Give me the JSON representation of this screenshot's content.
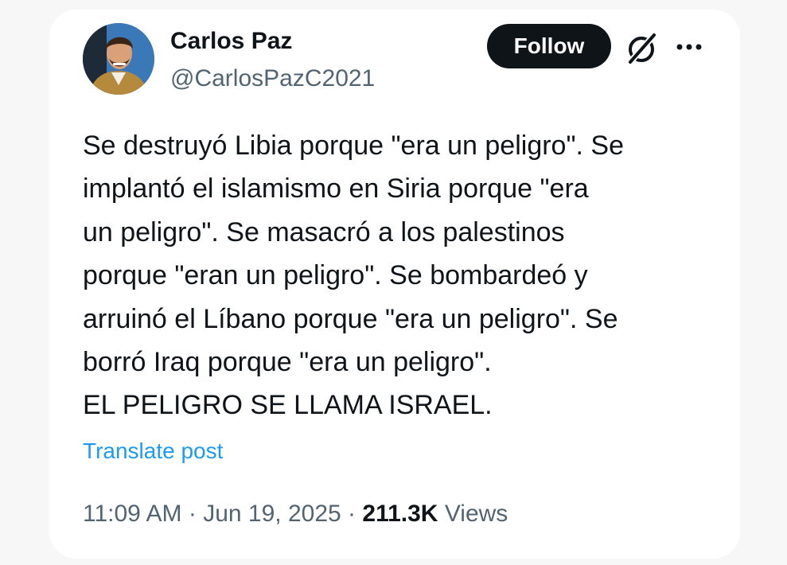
{
  "author": {
    "name": "Carlos Paz",
    "handle": "@CarlosPazC2021",
    "avatar_icon": "profile-photo"
  },
  "actions": {
    "follow_label": "Follow",
    "grok_icon": "grok-icon",
    "more_icon": "more-horizontal-icon"
  },
  "post": {
    "lines": [
      "Se destruyó Libia porque \"era un peligro\". Se",
      "implantó el islamismo en Siria porque \"era",
      "un peligro\". Se masacró a los palestinos",
      "porque \"eran un peligro\". Se bombardeó y",
      "arruinó el Líbano porque \"era un peligro\". Se",
      "borró Iraq porque \"era un peligro\".",
      "EL PELIGRO SE LLAMA ISRAEL."
    ],
    "translate_label": "Translate post"
  },
  "meta": {
    "time": "11:09 AM",
    "separator": "·",
    "date": "Jun 19, 2025",
    "views_count": "211.3K",
    "views_label": "Views"
  },
  "colors": {
    "text": "#0f1419",
    "secondary": "#536471",
    "link": "#1d9bf0",
    "button_bg": "#0f1419",
    "button_text": "#ffffff"
  }
}
